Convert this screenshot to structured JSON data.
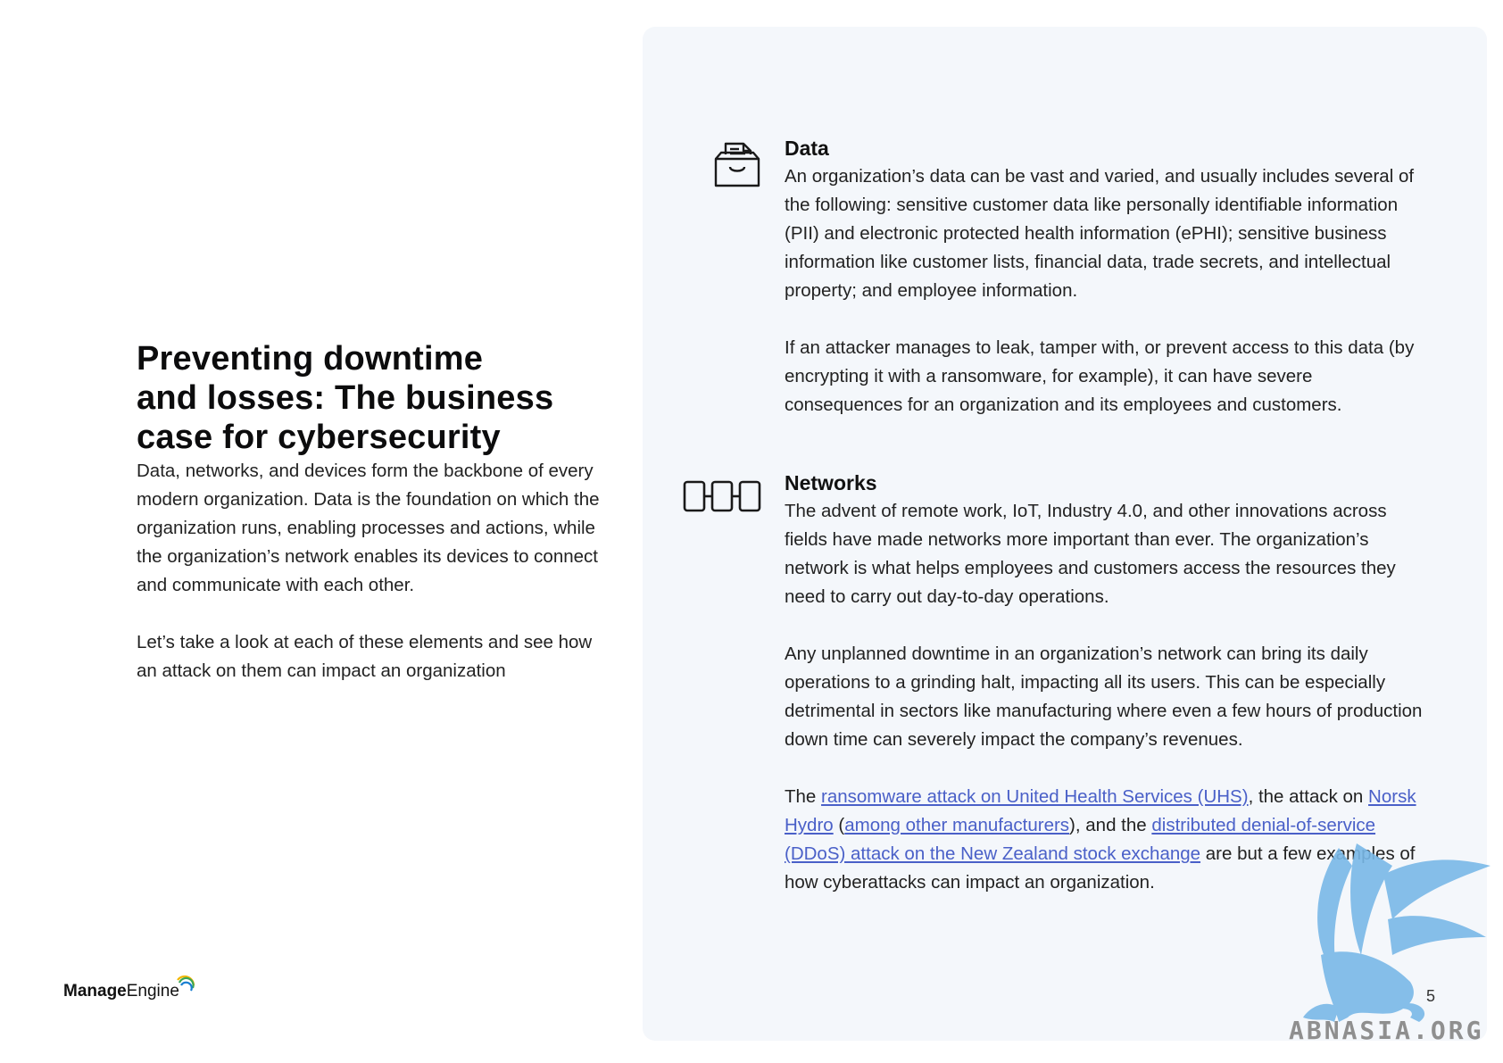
{
  "left": {
    "title_lines": [
      "Preventing downtime",
      "and losses: The business",
      "case for cybersecurity"
    ],
    "paragraphs": [
      "Data, networks, and devices form the backbone of every modern organization. Data is the foundation on which the organization runs, enabling processes and actions, while the organization’s network enables its devices to connect and communicate with each other.",
      "Let’s take a look at each of these elements and see how an attack on them can impact an organization"
    ]
  },
  "sections": {
    "data": {
      "heading": "Data",
      "icon": "folder-document-icon",
      "paragraphs": [
        "An organization’s data can be vast and varied, and usually includes several of the following: sensitive customer data like personally identifiable information (PII) and electronic protected health information (ePHI); sensitive business information like customer lists, financial data, trade secrets, and intellectual property; and employee information.",
        "If an attacker manages to leak, tamper with, or prevent access to this data (by encrypting it with a ransomware, for example), it can have severe consequences for an organization and its employees and customers."
      ]
    },
    "networks": {
      "heading": "Networks",
      "icon": "network-nodes-icon",
      "paragraphs": [
        "The advent of remote work, IoT, Industry 4.0, and other innovations across fields have made networks more important than ever. The organization’s network is what helps employees and customers access the resources they need to carry out day-to-day operations.",
        "Any unplanned downtime in an organization’s network can bring its daily operations to a grinding halt, impacting all its users. This can be especially detrimental in sectors like manufacturing where even a few hours of production down time can severely impact the company’s revenues."
      ],
      "examples": {
        "t1": "The ",
        "link1": "ransomware attack on United Health Services (UHS)",
        "t2": ", the attack on ",
        "link2": "Norsk Hydro",
        "t3": " (",
        "link3": "among other manufacturers",
        "t4": "), and the ",
        "link4": "distributed denial-of-service (DDoS) attack on the New Zealand stock exchange",
        "t5": " are but a few examples of how cyberattacks can impact an organization."
      }
    }
  },
  "footer": {
    "logo_bold": "Manage",
    "logo_regular": "Engine",
    "page_number": "5"
  },
  "watermark": {
    "text": "ABNASIA.ORG",
    "icon": "griffin-icon"
  },
  "colors": {
    "panel": "#f4f7fb",
    "link": "#4a60c8",
    "watermark_blue": "#79b8e8"
  }
}
